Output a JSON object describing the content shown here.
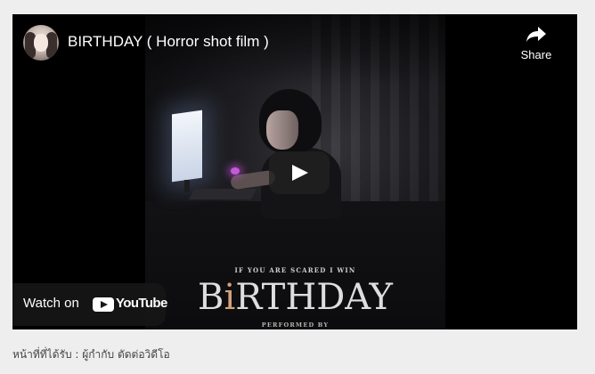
{
  "video": {
    "title": "BIRTHDAY ( Horror shot film )",
    "share_label": "Share",
    "watch_on_label": "Watch on",
    "youtube_wordmark": "YouTube",
    "play_icon": "play-icon",
    "share_icon": "share-arrow-icon"
  },
  "poster": {
    "tagline": "IF YOU ARE SCARED I WIN",
    "title_prefix": "B",
    "title_accent": "i",
    "title_suffix": "RTHDAY",
    "credit": "PERFORMED BY"
  },
  "caption": "หน้าที่ที่ได้รับ : ผู้กำกับ ตัดต่อวิดีโอ",
  "colors": {
    "page_background": "#eeeeee",
    "player_background": "#000000",
    "youtube_red": "#ff0000"
  }
}
